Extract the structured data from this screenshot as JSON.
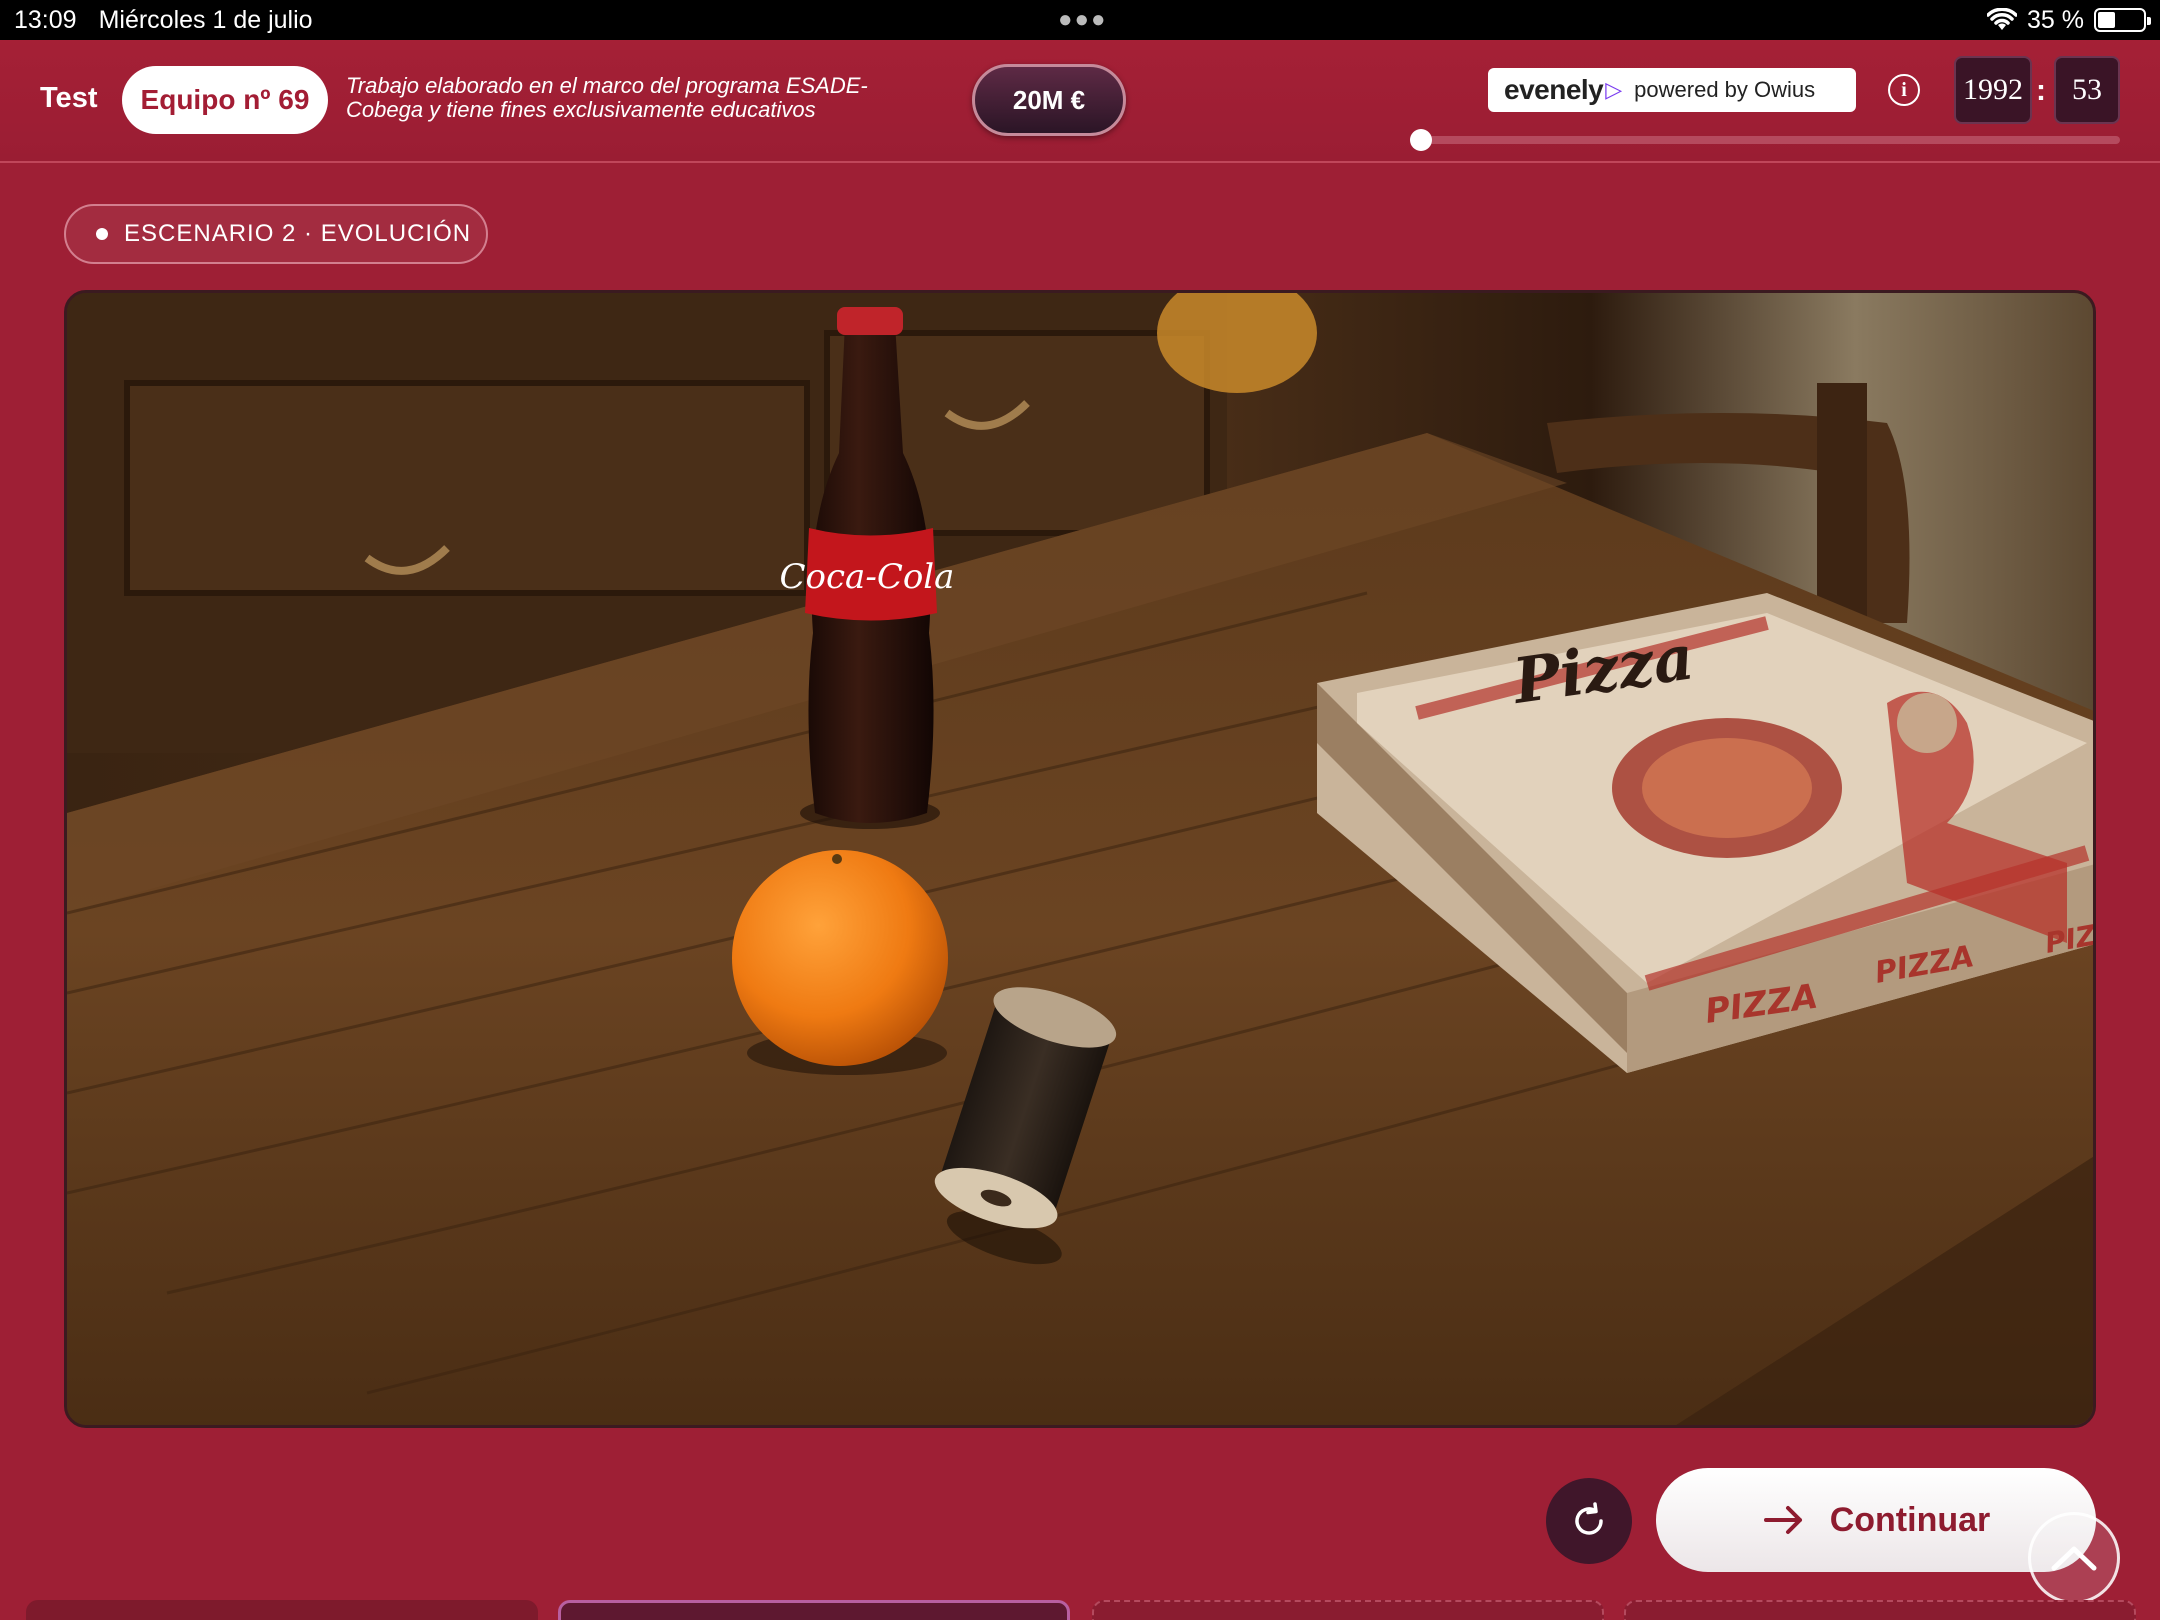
{
  "status_bar": {
    "time": "13:09",
    "date": "Miércoles 1 de julio",
    "battery": "35 %",
    "battery_level": 0.35
  },
  "header": {
    "title": "Test",
    "team": "Equipo nº 69",
    "disclaimer_line1": "Trabajo elaborado en el marco del programa ESADE-",
    "disclaimer_line2": "Cobega y tiene fines exclusivamente educativos",
    "budget": "20M €",
    "brand_logo": "evenely",
    "powered_by": "powered by Owius",
    "year": "1992",
    "separator": ":",
    "minutes": "53",
    "timeline_progress": 0
  },
  "scenario": {
    "label": "ESCENARIO 2 · EVOLUCIÓN"
  },
  "photo": {
    "pizza_lid": "Pizza",
    "pizza_side_1": "PIZZA",
    "pizza_side_2": "PIZZA",
    "pizza_side_3": "PIZ",
    "bottle_label": "Coca-Cola"
  },
  "actions": {
    "continue_label": "Continuar"
  },
  "icons": {
    "info": "info-icon",
    "refresh": "refresh-icon",
    "arrow": "arrow-right-icon",
    "scroll_up": "chevron-up-icon"
  },
  "colors": {
    "background": "#9e1f35",
    "accent": "#a31d34",
    "timer_box": "#3a1426"
  }
}
